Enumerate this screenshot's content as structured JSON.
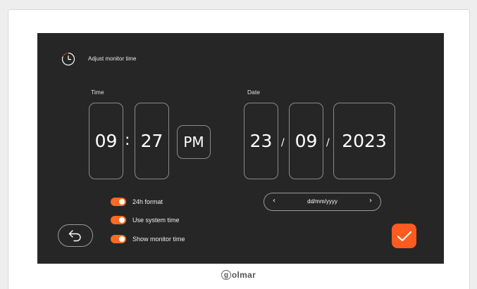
{
  "header": {
    "title": "Adjust monitor time",
    "icon": "clock-icon"
  },
  "time": {
    "label": "Time",
    "hours": "09",
    "sep": ":",
    "minutes": "27",
    "ampm": "PM"
  },
  "date": {
    "label": "Date",
    "day": "23",
    "month": "09",
    "year": "2023",
    "sep": "/"
  },
  "options": [
    {
      "label": "24h format",
      "on": true
    },
    {
      "label": "Use system time",
      "on": true
    },
    {
      "label": "Show monitor time",
      "on": true
    }
  ],
  "date_format": {
    "value": "dd/mm/yyyy",
    "prev": "‹",
    "next": "›"
  },
  "brand": {
    "logo_letter": "g",
    "logo_text": "olmar"
  },
  "colors": {
    "accent": "#ff6a22",
    "screen_bg": "#262626",
    "border": "#8a8a8a"
  }
}
